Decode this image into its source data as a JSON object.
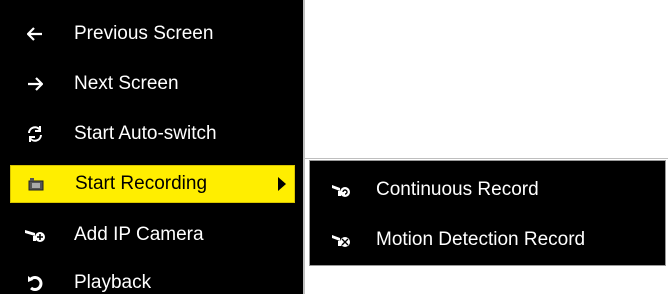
{
  "menu": {
    "items": [
      {
        "label": "Previous Screen",
        "icon": "arrow-left-icon",
        "selected": false
      },
      {
        "label": "Next Screen",
        "icon": "arrow-right-icon",
        "selected": false
      },
      {
        "label": "Start Auto-switch",
        "icon": "refresh-icon",
        "selected": false
      },
      {
        "label": "Start Recording",
        "icon": "recording-icon",
        "selected": true,
        "has_submenu": true
      },
      {
        "label": "Add IP Camera",
        "icon": "camera-add-icon",
        "selected": false
      },
      {
        "label": "Playback",
        "icon": "playback-icon",
        "selected": false
      }
    ]
  },
  "submenu": {
    "items": [
      {
        "label": "Continuous Record",
        "icon": "continuous-record-icon"
      },
      {
        "label": "Motion Detection Record",
        "icon": "motion-record-icon"
      }
    ]
  },
  "colors": {
    "menu_background": "#000000",
    "highlight": "#ffee00",
    "text": "#ffffff"
  }
}
